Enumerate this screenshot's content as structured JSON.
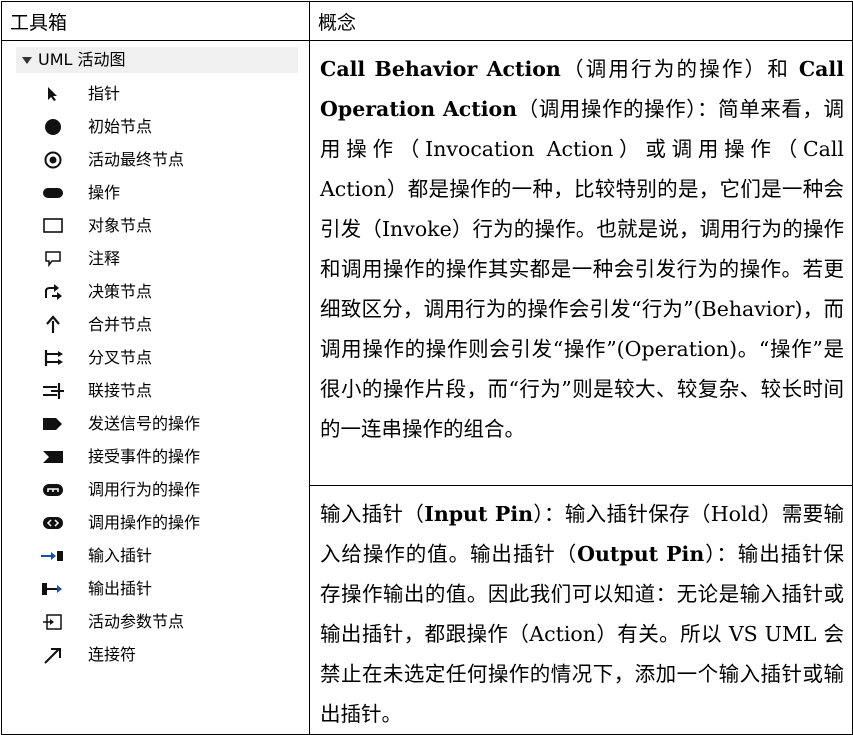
{
  "header": {
    "col1": "工具箱",
    "col2": "概念"
  },
  "toolbox": {
    "title": "UML 活动图",
    "items": [
      {
        "label": "指针",
        "icon": "pointer-icon"
      },
      {
        "label": "初始节点",
        "icon": "initial-node-icon"
      },
      {
        "label": "活动最终节点",
        "icon": "activity-final-icon"
      },
      {
        "label": "操作",
        "icon": "action-icon"
      },
      {
        "label": "对象节点",
        "icon": "object-node-icon"
      },
      {
        "label": "注释",
        "icon": "comment-icon"
      },
      {
        "label": "决策节点",
        "icon": "decision-node-icon"
      },
      {
        "label": "合并节点",
        "icon": "merge-node-icon"
      },
      {
        "label": "分叉节点",
        "icon": "fork-node-icon"
      },
      {
        "label": "联接节点",
        "icon": "join-node-icon"
      },
      {
        "label": "发送信号的操作",
        "icon": "send-signal-icon"
      },
      {
        "label": "接受事件的操作",
        "icon": "accept-event-icon"
      },
      {
        "label": "调用行为的操作",
        "icon": "call-behavior-icon"
      },
      {
        "label": "调用操作的操作",
        "icon": "call-operation-icon"
      },
      {
        "label": "输入插针",
        "icon": "input-pin-icon"
      },
      {
        "label": "输出插针",
        "icon": "output-pin-icon"
      },
      {
        "label": "活动参数节点",
        "icon": "activity-parameter-icon"
      },
      {
        "label": "连接符",
        "icon": "connector-icon"
      }
    ]
  },
  "concepts": {
    "p1": {
      "b1": "Call Behavior Action",
      "t1": "（调用行为的操作）和",
      "b2": "Call Operation Action",
      "t2": "（调用操作的操作）：简单来看，调用操作（Invocation Action）或调用操作（Call Action）都是操作的一种，比较特别的是，它们是一种会引发（Invoke）行为的操作。也就是说，调用行为的操作和调用操作的操作其实都是一种会引发行为的操作。若更细致区分，调用行为的操作会引发“行为”(Behavior)，而调用操作的操作则会引发“操作”(Operation)。“操作”是很小的操作片段，而“行为”则是较大、较复杂、较长时间的一连串操作的组合。"
    },
    "p2": {
      "t0": "输入插针（",
      "b1": "Input Pin",
      "t1": "）：输入插针保存（Hold）需要输入给操作的值。输出插针（",
      "b2": "Output Pin",
      "t2": "）：输出插针保存操作输出的值。因此我们可以知道：无论是输入插针或输出插针，都跟操作（Action）有关。所以 VS UML 会禁止在未选定任何操作的情况下，添加一个输入插针或输出插针。"
    }
  }
}
